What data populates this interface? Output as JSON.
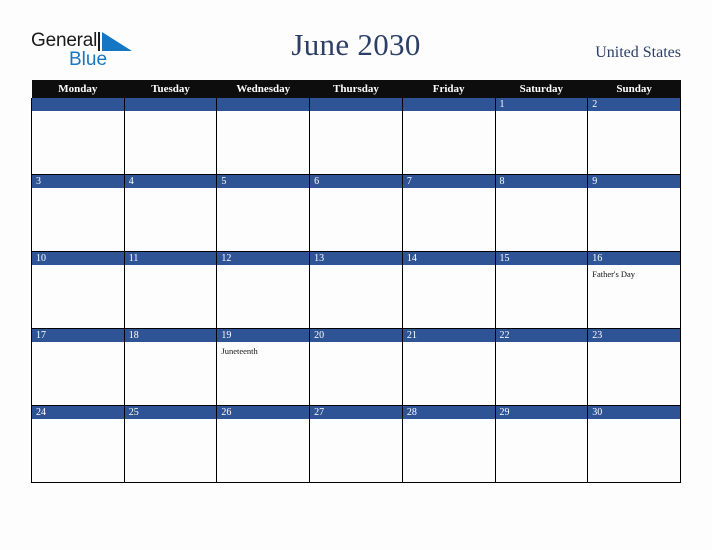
{
  "header": {
    "logo": {
      "word1": "General",
      "word2": "Blue",
      "triangle_icon": "blue-triangle-icon",
      "word1_color": "#1a1a1a",
      "word2_color": "#1577c4"
    },
    "title": "June 2030",
    "country": "United States"
  },
  "colors": {
    "header_bar": "#0d0d0d",
    "day_banner": "#2f5496",
    "title_text": "#2c3f66",
    "page_background": "#fdfdfd",
    "grid_border": "#000000"
  },
  "calendar": {
    "weekday_headers": [
      "Monday",
      "Tuesday",
      "Wednesday",
      "Thursday",
      "Friday",
      "Saturday",
      "Sunday"
    ],
    "weeks": [
      [
        {
          "day": "",
          "event": ""
        },
        {
          "day": "",
          "event": ""
        },
        {
          "day": "",
          "event": ""
        },
        {
          "day": "",
          "event": ""
        },
        {
          "day": "",
          "event": ""
        },
        {
          "day": "1",
          "event": ""
        },
        {
          "day": "2",
          "event": ""
        }
      ],
      [
        {
          "day": "3",
          "event": ""
        },
        {
          "day": "4",
          "event": ""
        },
        {
          "day": "5",
          "event": ""
        },
        {
          "day": "6",
          "event": ""
        },
        {
          "day": "7",
          "event": ""
        },
        {
          "day": "8",
          "event": ""
        },
        {
          "day": "9",
          "event": ""
        }
      ],
      [
        {
          "day": "10",
          "event": ""
        },
        {
          "day": "11",
          "event": ""
        },
        {
          "day": "12",
          "event": ""
        },
        {
          "day": "13",
          "event": ""
        },
        {
          "day": "14",
          "event": ""
        },
        {
          "day": "15",
          "event": ""
        },
        {
          "day": "16",
          "event": "Father's Day"
        }
      ],
      [
        {
          "day": "17",
          "event": ""
        },
        {
          "day": "18",
          "event": ""
        },
        {
          "day": "19",
          "event": "Juneteenth"
        },
        {
          "day": "20",
          "event": ""
        },
        {
          "day": "21",
          "event": ""
        },
        {
          "day": "22",
          "event": ""
        },
        {
          "day": "23",
          "event": ""
        }
      ],
      [
        {
          "day": "24",
          "event": ""
        },
        {
          "day": "25",
          "event": ""
        },
        {
          "day": "26",
          "event": ""
        },
        {
          "day": "27",
          "event": ""
        },
        {
          "day": "28",
          "event": ""
        },
        {
          "day": "29",
          "event": ""
        },
        {
          "day": "30",
          "event": ""
        }
      ]
    ]
  }
}
